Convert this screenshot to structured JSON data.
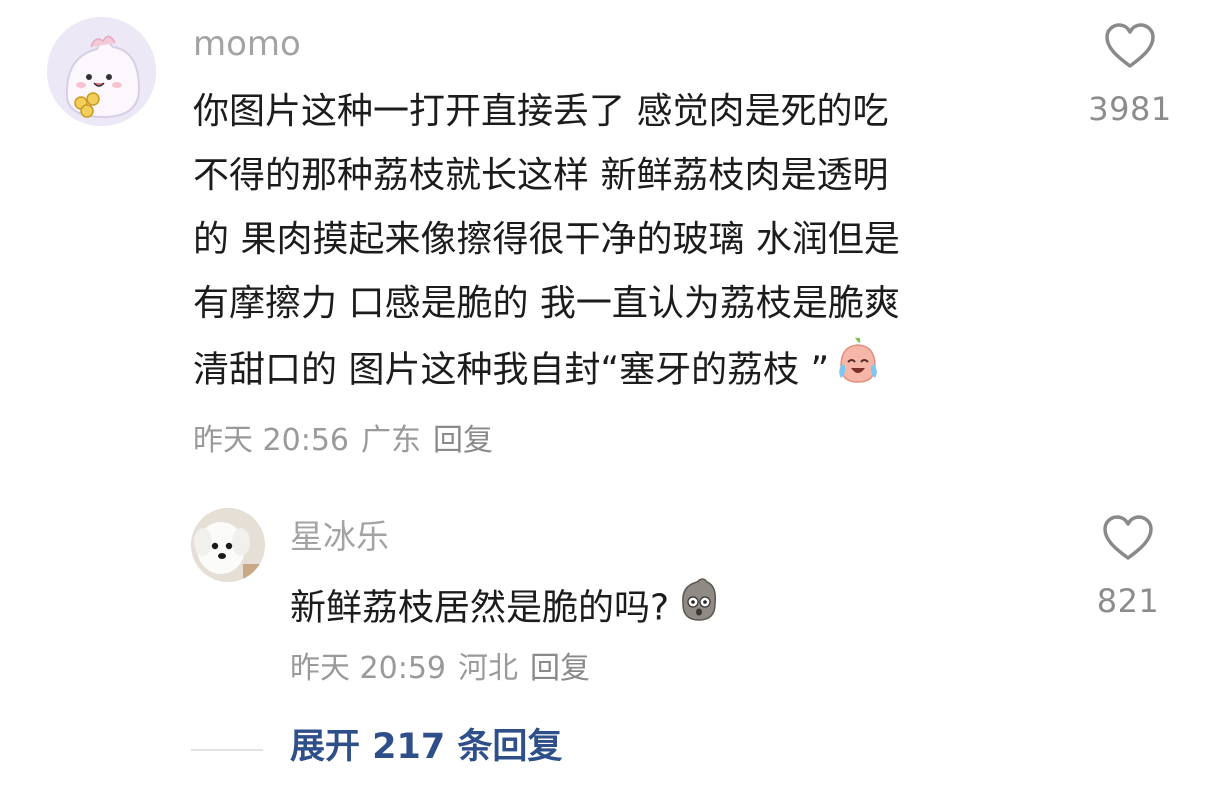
{
  "comments": [
    {
      "username": "momo",
      "text_lines": [
        "你图片这种一打开直接丢了   感觉肉是死的吃",
        "不得的那种荔枝就长这样    新鲜荔枝肉是透明",
        "的  果肉摸起来像擦得很干净的玻璃 水润但是",
        "有摩擦力  口感是脆的   我一直认为荔枝是脆爽",
        "清甜口的   图片这种我自封“塞牙的荔枝 ”"
      ],
      "time": "昨天 20:56",
      "location": "广东",
      "reply_label": "回复",
      "likes": "3981",
      "avatar_icon": "cartoon-avatar-icon",
      "trailing_emoji": "crying-laugh-emoji"
    },
    {
      "username": "星冰乐",
      "text": "新鲜荔枝居然是脆的吗?",
      "time": "昨天 20:59",
      "location": "河北",
      "reply_label": "回复",
      "likes": "821",
      "avatar_icon": "white-dog-avatar-icon",
      "trailing_emoji": "shocked-potato-emoji"
    }
  ],
  "expand_replies": "展开 217 条回复",
  "colors": {
    "username": "#a3a3a3",
    "meta": "#9a9a9a",
    "expand_link": "#2f4f8a",
    "text": "#1c1c1c"
  }
}
